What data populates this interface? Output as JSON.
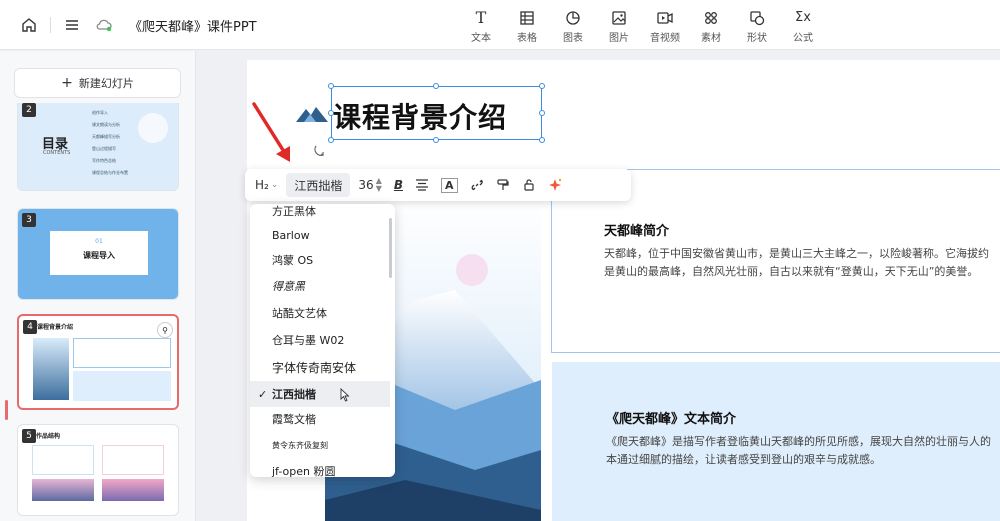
{
  "header": {
    "doc_title": "《爬天都峰》课件PPT",
    "tools": [
      {
        "label": "文本",
        "icon": "text-icon"
      },
      {
        "label": "表格",
        "icon": "table-icon"
      },
      {
        "label": "图表",
        "icon": "chart-icon"
      },
      {
        "label": "图片",
        "icon": "image-icon"
      },
      {
        "label": "音视频",
        "icon": "video-icon"
      },
      {
        "label": "素材",
        "icon": "material-icon"
      },
      {
        "label": "形状",
        "icon": "shape-icon"
      },
      {
        "label": "公式",
        "icon": "formula-icon"
      }
    ],
    "tool_glyph_text": "T",
    "tool_glyph_formula": "Σx"
  },
  "sidebar": {
    "new_slide_label": "新建幻灯片",
    "slides": [
      {
        "num": "2",
        "title": "目录",
        "subtitle": "CONTENTS",
        "items": [
          "创作导入",
          "课文朗读与分析",
          "天都峰描写分析",
          "登山过程描写",
          "写作特色总结",
          "课程总结与作业布置"
        ]
      },
      {
        "num": "3",
        "small": "01",
        "title": "课程导入"
      },
      {
        "num": "4",
        "title": "课程背景介绍"
      },
      {
        "num": "5",
        "title": "作品结构"
      }
    ]
  },
  "slide": {
    "title": "课程背景介绍",
    "panel1": {
      "title": "天都峰简介",
      "line1": "天都峰，位于中国安徽省黄山市，是黄山三大主峰之一，以险峻著称。它海拔约",
      "line2": "是黄山的最高峰，自然风光壮丽，自古以来就有“登黄山，天下无山”的美誉。"
    },
    "panel2": {
      "title": "《爬天都峰》文本简介",
      "line1": "《爬天都峰》是描写作者登临黄山天都峰的所见所感，展现大自然的壮丽与人的",
      "line2": "本通过细腻的描绘，让读者感受到登山的艰辛与成就感。"
    }
  },
  "text_toolbar": {
    "heading": "H₂",
    "font": "江西拙楷",
    "size": "36",
    "bold_glyph": "B",
    "color_glyph": "A"
  },
  "font_dropdown": {
    "items": [
      "方正黑体",
      "Barlow",
      "鸿蒙 OS",
      "得意黑",
      "站酷文艺体",
      "仓耳与墨 W02",
      "字体传奇南安体",
      "江西拙楷",
      "霞鹜文楷",
      "黄令东齐伋复刻",
      "jf-open 粉圆"
    ],
    "selected": "江西拙楷"
  },
  "colors": {
    "accent": "#3a8dde",
    "active_slide": "#e86a6a",
    "arrow": "#e02a2a"
  }
}
